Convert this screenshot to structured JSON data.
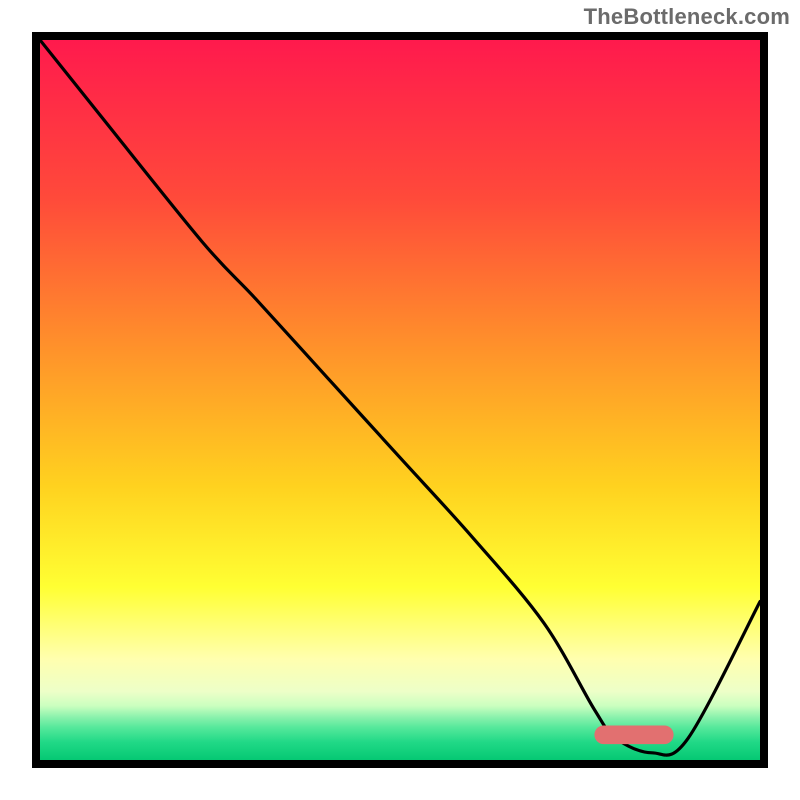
{
  "attribution": "TheBottleneck.com",
  "chart_data": {
    "type": "line",
    "title": "",
    "xlabel": "",
    "ylabel": "",
    "xlim": [
      0,
      100
    ],
    "ylim": [
      0,
      100
    ],
    "grid": false,
    "legend": false,
    "gradient_stops": [
      {
        "pos": 0.0,
        "color": "#ff1a4d"
      },
      {
        "pos": 0.22,
        "color": "#ff4a3a"
      },
      {
        "pos": 0.42,
        "color": "#ff8f2b"
      },
      {
        "pos": 0.62,
        "color": "#ffd21f"
      },
      {
        "pos": 0.76,
        "color": "#ffff33"
      },
      {
        "pos": 0.86,
        "color": "#ffffaf"
      },
      {
        "pos": 0.905,
        "color": "#edffc8"
      },
      {
        "pos": 0.925,
        "color": "#caffbf"
      },
      {
        "pos": 0.94,
        "color": "#8cf2ad"
      },
      {
        "pos": 0.955,
        "color": "#55e89b"
      },
      {
        "pos": 0.975,
        "color": "#21d987"
      },
      {
        "pos": 1.0,
        "color": "#05c873"
      }
    ],
    "series": [
      {
        "name": "bottleneck-curve",
        "color": "#000000",
        "x": [
          0,
          8,
          22.5,
          30,
          40,
          50,
          60,
          70,
          77,
          80,
          85,
          90,
          100
        ],
        "values": [
          100,
          90,
          72,
          64,
          53,
          42,
          31,
          19,
          7,
          3,
          1,
          3,
          22
        ]
      }
    ],
    "marker": {
      "name": "optimal-range",
      "color": "#e27070",
      "x_start": 77,
      "x_end": 88,
      "y": 3.5,
      "thickness_pct": 2.6
    }
  }
}
